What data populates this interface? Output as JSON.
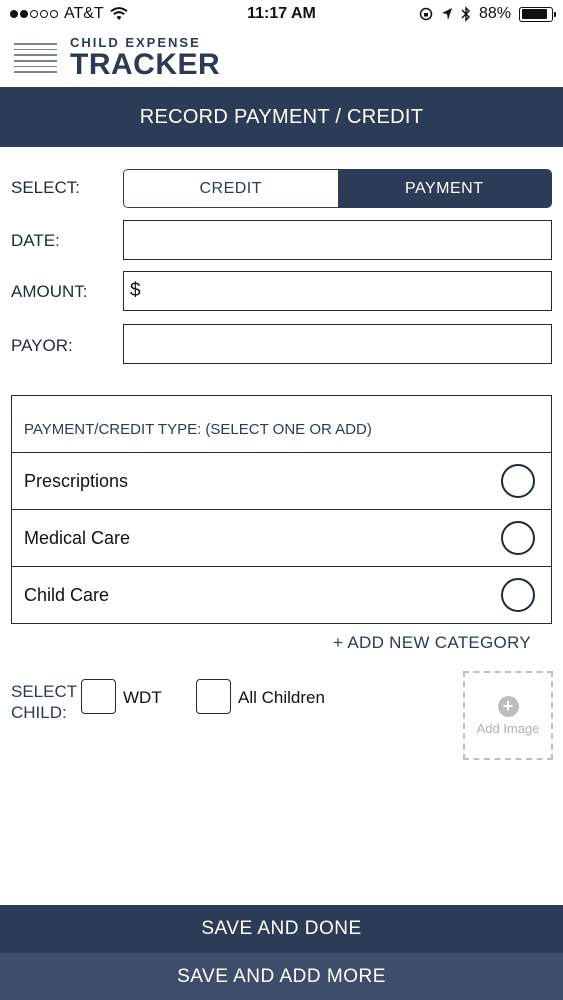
{
  "status_bar": {
    "carrier": "AT&T",
    "time": "11:17 AM",
    "battery": "88%",
    "battery_level": 0.88,
    "signal_bars": 2
  },
  "header": {
    "logo_top": "CHILD EXPENSE",
    "logo_main": "TRACKER"
  },
  "title": "RECORD PAYMENT / CREDIT",
  "form": {
    "select_label": "SELECT:",
    "segments": [
      {
        "label": "CREDIT",
        "active": false
      },
      {
        "label": "PAYMENT",
        "active": true
      }
    ],
    "date_label": "DATE:",
    "date_value": "",
    "amount_label": "AMOUNT:",
    "amount_prefix": "$",
    "amount_value": "",
    "payor_label": "PAYOR:",
    "payor_value": ""
  },
  "categories": {
    "header": "PAYMENT/CREDIT TYPE: (SELECT ONE OR ADD)",
    "items": [
      {
        "label": "Prescriptions"
      },
      {
        "label": "Medical Care"
      },
      {
        "label": "Child Care"
      }
    ],
    "add_new": "+ ADD NEW CATEGORY"
  },
  "children": {
    "label_line1": "SELECT",
    "label_line2": "CHILD:",
    "options": [
      {
        "label": "WDT"
      },
      {
        "label": "All Children"
      }
    ]
  },
  "add_image": {
    "label": "Add Image"
  },
  "buttons": {
    "save_done": "SAVE AND DONE",
    "save_more": "SAVE AND ADD MORE"
  },
  "colors": {
    "primary": "#2c3b56",
    "secondary": "#3d4d6a"
  }
}
